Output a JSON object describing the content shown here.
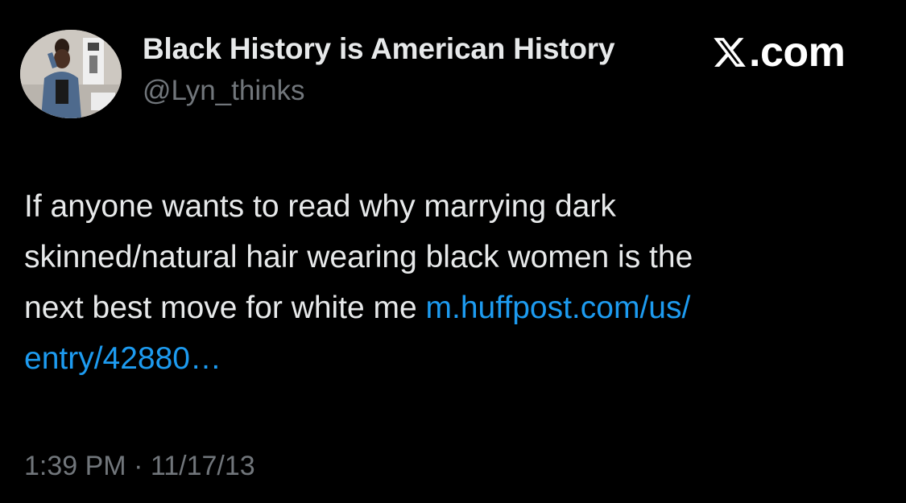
{
  "author": {
    "display_name": "Black History is American History",
    "handle": "@Lyn_thinks",
    "avatar_icon": "profile-photo"
  },
  "brand": {
    "text": ".com",
    "icon": "x-logo-icon"
  },
  "tweet": {
    "text_line1": "If anyone wants to read why marrying dark",
    "text_line2": "skinned/natural hair wearing black women is the",
    "text_line3": "next best move for white me ",
    "link_line1": "m.huffpost.com/us/",
    "link_line2": "entry/42880…",
    "time": "1:39 PM",
    "separator": "·",
    "date": "11/17/13"
  },
  "colors": {
    "background": "#000000",
    "primary_text": "#e7e9ea",
    "secondary_text": "#71767b",
    "link": "#1d9bf0"
  }
}
